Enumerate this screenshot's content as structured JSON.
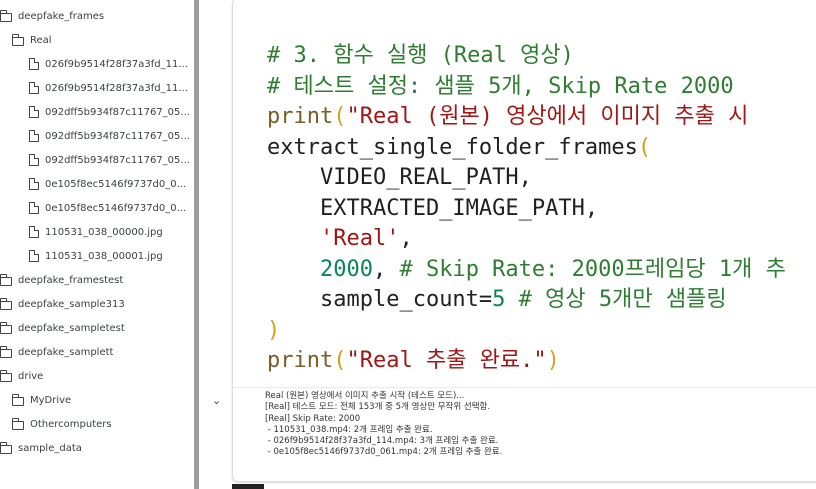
{
  "file_tree": {
    "items": [
      {
        "label": "deepfake_frames",
        "kind": "folder"
      },
      {
        "label": "Real",
        "kind": "folder"
      },
      {
        "label": "026f9b9514f28f37a3fd_11...",
        "kind": "file"
      },
      {
        "label": "026f9b9514f28f37a3fd_11...",
        "kind": "file"
      },
      {
        "label": "092dff5b934f87c11767_05...",
        "kind": "file"
      },
      {
        "label": "092dff5b934f87c11767_05...",
        "kind": "file"
      },
      {
        "label": "092dff5b934f87c11767_05...",
        "kind": "file"
      },
      {
        "label": "0e105f8ec5146f9737d0_0...",
        "kind": "file"
      },
      {
        "label": "0e105f8ec5146f9737d0_0...",
        "kind": "file"
      },
      {
        "label": "110531_038_00000.jpg",
        "kind": "file"
      },
      {
        "label": "110531_038_00001.jpg",
        "kind": "file"
      },
      {
        "label": "deepfake_framestest",
        "kind": "folder"
      },
      {
        "label": "deepfake_sample313",
        "kind": "folder"
      },
      {
        "label": "deepfake_sampletest",
        "kind": "folder"
      },
      {
        "label": "deepfake_samplett",
        "kind": "folder"
      },
      {
        "label": "drive",
        "kind": "folder"
      },
      {
        "label": "MyDrive",
        "kind": "folder"
      },
      {
        "label": "Othercomputers",
        "kind": "folder"
      },
      {
        "label": "sample_data",
        "kind": "folder"
      }
    ]
  },
  "code_cell": {
    "line1": "# 3. 함수 실행 (Real 영상)",
    "line2": "# 테스트 설정: 샘플 5개, Skip Rate 2000",
    "line3_fn": "print",
    "line3_open": "(",
    "line3_str": "\"Real (원본) 영상에서 이미지 추출 시",
    "line4_fn": "extract_single_folder_frames",
    "line4_open": "(",
    "line5": "    VIDEO_REAL_PATH,",
    "line6": "    EXTRACTED_IMAGE_PATH,",
    "line7_indent": "    ",
    "line7_str": "'Real'",
    "line7_tail": ",",
    "line8_indent": "    ",
    "line8_num": "2000",
    "line8_comma": ", ",
    "line8_comment": "# Skip Rate: 2000프레임당 1개 추",
    "line9_indent": "    ",
    "line9_kw": "sample_count=",
    "line9_num": "5",
    "line9_sp": " ",
    "line9_comment": "# 영상 5개만 샘플링",
    "line10": ")",
    "line11_fn": "print",
    "line11_open": "(",
    "line11_str": "\"Real 추출 완료.\"",
    "line11_close": ")"
  },
  "cell_output": {
    "lines": [
      "Real (원본) 영상에서 이미지 추출 시작 (테스트 모드)...",
      "[Real] 테스트 모드: 전체 153개 중 5개 영상만 무작위 선택함.",
      "[Real] Skip Rate: 2000",
      " - 110531_038.mp4: 2개 프레임 추출 완료.",
      " - 026f9b9514f28f37a3fd_114.mp4: 3개 프레임 추출 완료.",
      " - 0e105f8ec5146f9737d0_061.mp4: 2개 프레임 추출 완료."
    ]
  },
  "ui": {
    "collapse_icon": "chevron-down-icon"
  }
}
